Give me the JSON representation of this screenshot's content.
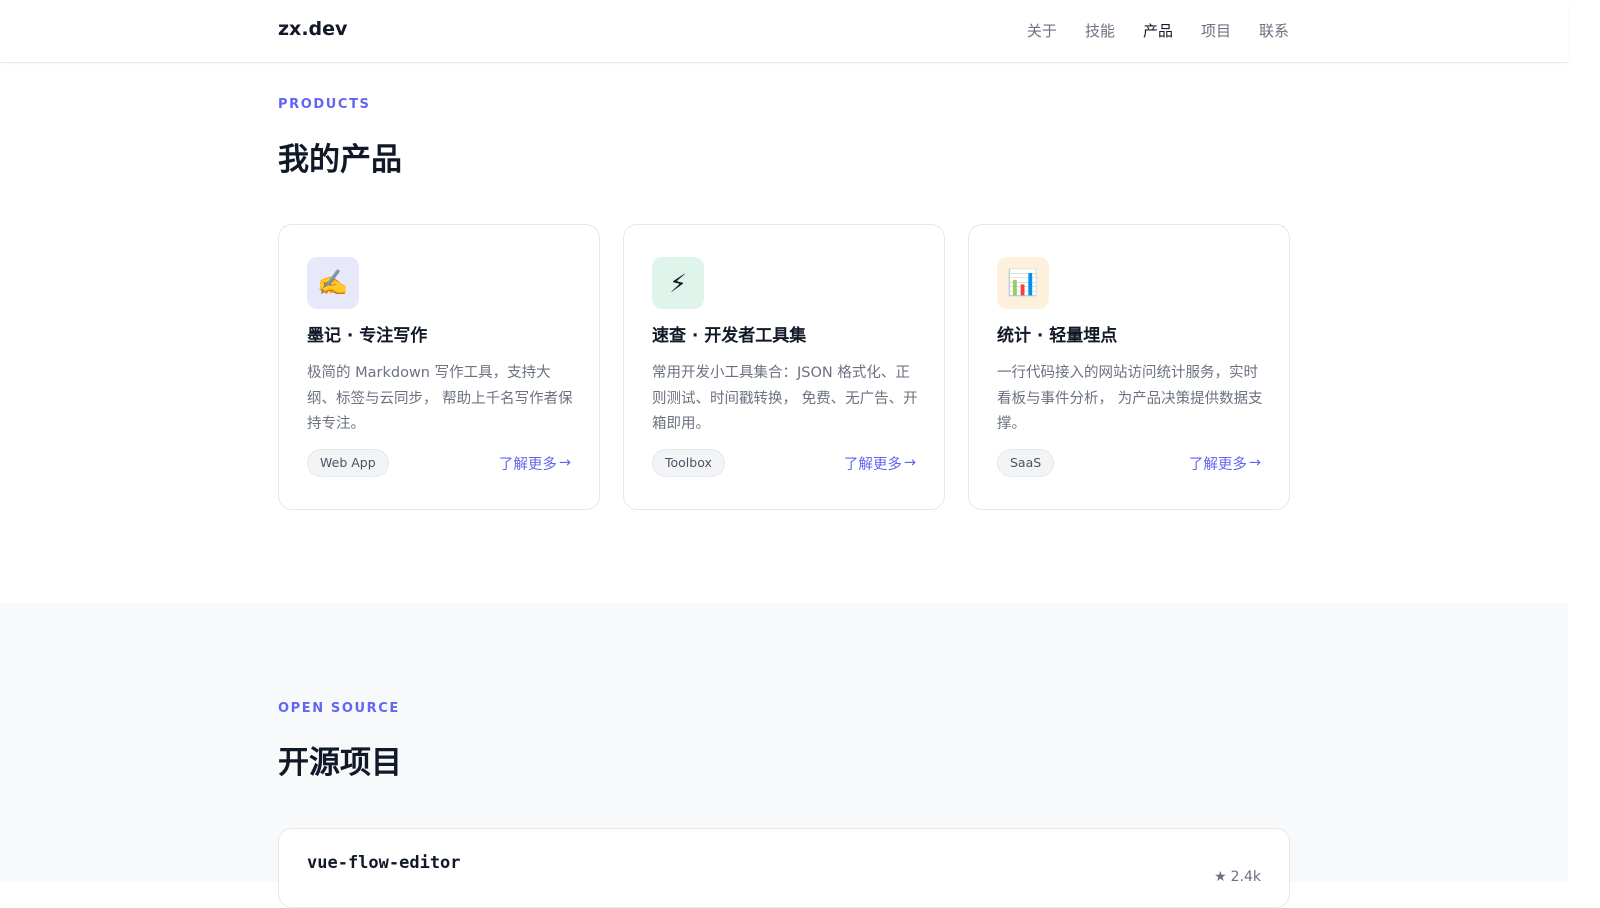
{
  "nav": {
    "brand": "zx.dev",
    "links": [
      {
        "label": "关于"
      },
      {
        "label": "技能"
      },
      {
        "label": "产品"
      },
      {
        "label": "项目"
      },
      {
        "label": "联系"
      }
    ],
    "active": "产品"
  },
  "products": {
    "eyebrow": "PRODUCTS",
    "title": "我的产品",
    "items": [
      {
        "icon": "✍️",
        "icon_name": "writing-hand-icon",
        "icon_bg": "#e8e8fb",
        "title": "墨记 · 专注写作",
        "desc": "极简的 Markdown 写作工具，支持大纲、标签与云同步， 帮助上千名写作者保持专注。",
        "tag": "Web App",
        "more": "了解更多"
      },
      {
        "icon": "⚡",
        "icon_name": "lightning-icon",
        "icon_bg": "#dff5ec",
        "title": "速查 · 开发者工具集",
        "desc": "常用开发小工具集合：JSON 格式化、正则测试、时间戳转换， 免费、无广告、开箱即用。",
        "tag": "Toolbox",
        "more": "了解更多"
      },
      {
        "icon": "📊",
        "icon_name": "bar-chart-icon",
        "icon_bg": "#fdf0dc",
        "title": "统计 · 轻量埋点",
        "desc": "一行代码接入的网站访问统计服务，实时看板与事件分析， 为产品决策提供数据支撑。",
        "tag": "SaaS",
        "more": "了解更多"
      }
    ],
    "arrow": "→"
  },
  "opensource": {
    "eyebrow": "OPEN SOURCE",
    "title": "开源项目",
    "repo": {
      "name": "vue-flow-editor",
      "star": "★",
      "stars": "2.4k"
    }
  },
  "colors": {
    "accent": "#6366f1",
    "text": "#111827",
    "muted": "#6b7280",
    "border": "#e5e7eb",
    "band": "#f8f9fb"
  }
}
